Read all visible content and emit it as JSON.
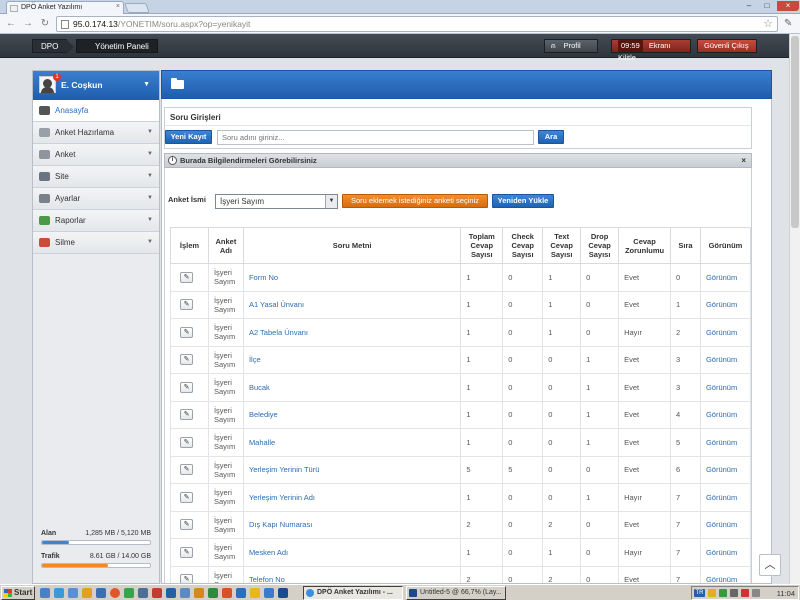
{
  "browser": {
    "tab_title": "DPÖ Anket Yazılımı",
    "url_host": "95.0.174.13",
    "url_path": "/YONETIM/soru.aspx?op=yenikayit"
  },
  "header": {
    "home": "DPO",
    "panel": "Yönetim Paneli",
    "profile": "Profil",
    "session_time": "09:59",
    "lock_screen": "Ekranı Kilitle",
    "logout": "Güvenli Çıkış"
  },
  "sidebar": {
    "username": "E. Coşkun",
    "badge": "1",
    "items": [
      {
        "label": "Anasayfa",
        "icon": "cloud-icon",
        "color": "#555555"
      },
      {
        "label": "Anket Hazırlama",
        "icon": "clipboard-icon",
        "color": "#9aa0a8"
      },
      {
        "label": "Anket",
        "icon": "survey-icon",
        "color": "#8f959d"
      },
      {
        "label": "Site",
        "icon": "site-icon",
        "color": "#6a7480"
      },
      {
        "label": "Ayarlar",
        "icon": "settings-icon",
        "color": "#7b8189"
      },
      {
        "label": "Raporlar",
        "icon": "report-icon",
        "color": "#4a9a4a"
      },
      {
        "label": "Silme",
        "icon": "delete-icon",
        "color": "#d04a3a"
      }
    ],
    "usage": {
      "storage_label": "Alan",
      "storage_value": "1,285 MB / 5,120 MB",
      "storage_fraction": 0.25,
      "traffic_label": "Trafik",
      "traffic_value": "8.61 GB / 14.00 GB",
      "traffic_fraction": 0.615
    }
  },
  "entry": {
    "title": "Soru Girişleri",
    "new_button": "Yeni Kayıt",
    "search_placeholder": "Soru adını giriniz...",
    "search_button": "Ara"
  },
  "info": {
    "text": "Burada Bilgilendirmeleri Görebilirsiniz",
    "close": "×"
  },
  "survey": {
    "label": "Anket İsmi",
    "selected": "İşyeri Sayım",
    "hint_button": "Soru eklemek istediğiniz anketi seçiniz",
    "reload_button": "Yeniden Yükle"
  },
  "table": {
    "headers": [
      "İşlem",
      "Anket Adı",
      "Soru Metni",
      "Toplam Cevap Sayısı",
      "Check Cevap Sayısı",
      "Text Cevap Sayısı",
      "Drop Cevap Sayısı",
      "Cevap Zorunlumu",
      "Sıra",
      "Görünüm"
    ],
    "rows": [
      {
        "survey": "İşyeri Sayım",
        "question": "Form No",
        "total": "1",
        "check": "0",
        "text": "1",
        "drop": "0",
        "required": "Evet",
        "order": "0",
        "view": "Görünüm"
      },
      {
        "survey": "İşyeri Sayım",
        "question": "A1 Yasal Ünvanı",
        "total": "1",
        "check": "0",
        "text": "1",
        "drop": "0",
        "required": "Evet",
        "order": "1",
        "view": "Görünüm"
      },
      {
        "survey": "İşyeri Sayım",
        "question": "A2 Tabela Ünvanı",
        "total": "1",
        "check": "0",
        "text": "1",
        "drop": "0",
        "required": "Hayır",
        "order": "2",
        "view": "Görünüm"
      },
      {
        "survey": "İşyeri Sayım",
        "question": "İlçe",
        "total": "1",
        "check": "0",
        "text": "0",
        "drop": "1",
        "required": "Evet",
        "order": "3",
        "view": "Görünüm"
      },
      {
        "survey": "İşyeri Sayım",
        "question": "Bucak",
        "total": "1",
        "check": "0",
        "text": "0",
        "drop": "1",
        "required": "Evet",
        "order": "3",
        "view": "Görünüm"
      },
      {
        "survey": "İşyeri Sayım",
        "question": "Belediye",
        "total": "1",
        "check": "0",
        "text": "0",
        "drop": "1",
        "required": "Evet",
        "order": "4",
        "view": "Görünüm"
      },
      {
        "survey": "İşyeri Sayım",
        "question": "Mahalle",
        "total": "1",
        "check": "0",
        "text": "0",
        "drop": "1",
        "required": "Evet",
        "order": "5",
        "view": "Görünüm"
      },
      {
        "survey": "İşyeri Sayım",
        "question": "Yerleşim Yerinin Türü",
        "total": "5",
        "check": "5",
        "text": "0",
        "drop": "0",
        "required": "Evet",
        "order": "6",
        "view": "Görünüm"
      },
      {
        "survey": "İşyeri Sayım",
        "question": "Yerleşim Yerinin Adı",
        "total": "1",
        "check": "0",
        "text": "0",
        "drop": "1",
        "required": "Hayır",
        "order": "7",
        "view": "Görünüm"
      },
      {
        "survey": "İşyeri Sayım",
        "question": "Dış Kapı Numarası",
        "total": "2",
        "check": "0",
        "text": "2",
        "drop": "0",
        "required": "Evet",
        "order": "7",
        "view": "Görünüm"
      },
      {
        "survey": "İşyeri Sayım",
        "question": "Mesken Adı",
        "total": "1",
        "check": "0",
        "text": "1",
        "drop": "0",
        "required": "Hayır",
        "order": "7",
        "view": "Görünüm"
      },
      {
        "survey": "İşyeri Sayım",
        "question": "Telefon No",
        "total": "2",
        "check": "0",
        "text": "2",
        "drop": "0",
        "required": "Evet",
        "order": "7",
        "view": "Görünüm"
      }
    ]
  },
  "taskbar": {
    "start": "Start",
    "tasks": [
      "DPÖ Anket Yazılımı - ...",
      "Untitled-5 @ 66,7% (Lay..."
    ],
    "lang": "TR",
    "clock": "11:04"
  },
  "colors": {
    "accent_blue": "#1e5dac",
    "header_dark": "#2f353c",
    "danger_red": "#992e22",
    "orange": "#d66d10",
    "link_blue": "#2b6cb3",
    "storage_fill": "#3a86d6",
    "traffic_fill": "#f08a22"
  }
}
